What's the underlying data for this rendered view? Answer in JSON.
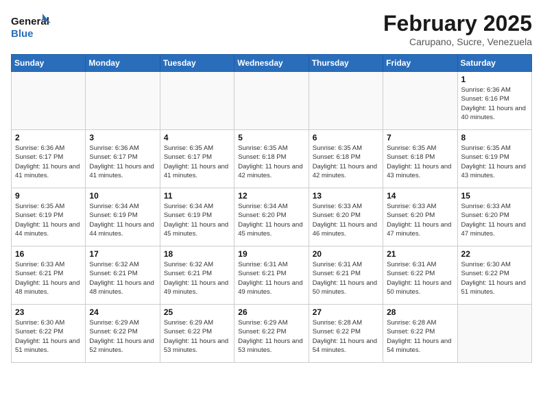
{
  "header": {
    "logo_line1": "General",
    "logo_line2": "Blue",
    "month": "February 2025",
    "location": "Carupano, Sucre, Venezuela"
  },
  "weekdays": [
    "Sunday",
    "Monday",
    "Tuesday",
    "Wednesday",
    "Thursday",
    "Friday",
    "Saturday"
  ],
  "weeks": [
    [
      {
        "day": "",
        "sunrise": "",
        "sunset": "",
        "daylight": ""
      },
      {
        "day": "",
        "sunrise": "",
        "sunset": "",
        "daylight": ""
      },
      {
        "day": "",
        "sunrise": "",
        "sunset": "",
        "daylight": ""
      },
      {
        "day": "",
        "sunrise": "",
        "sunset": "",
        "daylight": ""
      },
      {
        "day": "",
        "sunrise": "",
        "sunset": "",
        "daylight": ""
      },
      {
        "day": "",
        "sunrise": "",
        "sunset": "",
        "daylight": ""
      },
      {
        "day": "1",
        "sunrise": "Sunrise: 6:36 AM",
        "sunset": "Sunset: 6:16 PM",
        "daylight": "Daylight: 11 hours and 40 minutes."
      }
    ],
    [
      {
        "day": "2",
        "sunrise": "Sunrise: 6:36 AM",
        "sunset": "Sunset: 6:17 PM",
        "daylight": "Daylight: 11 hours and 41 minutes."
      },
      {
        "day": "3",
        "sunrise": "Sunrise: 6:36 AM",
        "sunset": "Sunset: 6:17 PM",
        "daylight": "Daylight: 11 hours and 41 minutes."
      },
      {
        "day": "4",
        "sunrise": "Sunrise: 6:35 AM",
        "sunset": "Sunset: 6:17 PM",
        "daylight": "Daylight: 11 hours and 41 minutes."
      },
      {
        "day": "5",
        "sunrise": "Sunrise: 6:35 AM",
        "sunset": "Sunset: 6:18 PM",
        "daylight": "Daylight: 11 hours and 42 minutes."
      },
      {
        "day": "6",
        "sunrise": "Sunrise: 6:35 AM",
        "sunset": "Sunset: 6:18 PM",
        "daylight": "Daylight: 11 hours and 42 minutes."
      },
      {
        "day": "7",
        "sunrise": "Sunrise: 6:35 AM",
        "sunset": "Sunset: 6:18 PM",
        "daylight": "Daylight: 11 hours and 43 minutes."
      },
      {
        "day": "8",
        "sunrise": "Sunrise: 6:35 AM",
        "sunset": "Sunset: 6:19 PM",
        "daylight": "Daylight: 11 hours and 43 minutes."
      }
    ],
    [
      {
        "day": "9",
        "sunrise": "Sunrise: 6:35 AM",
        "sunset": "Sunset: 6:19 PM",
        "daylight": "Daylight: 11 hours and 44 minutes."
      },
      {
        "day": "10",
        "sunrise": "Sunrise: 6:34 AM",
        "sunset": "Sunset: 6:19 PM",
        "daylight": "Daylight: 11 hours and 44 minutes."
      },
      {
        "day": "11",
        "sunrise": "Sunrise: 6:34 AM",
        "sunset": "Sunset: 6:19 PM",
        "daylight": "Daylight: 11 hours and 45 minutes."
      },
      {
        "day": "12",
        "sunrise": "Sunrise: 6:34 AM",
        "sunset": "Sunset: 6:20 PM",
        "daylight": "Daylight: 11 hours and 45 minutes."
      },
      {
        "day": "13",
        "sunrise": "Sunrise: 6:33 AM",
        "sunset": "Sunset: 6:20 PM",
        "daylight": "Daylight: 11 hours and 46 minutes."
      },
      {
        "day": "14",
        "sunrise": "Sunrise: 6:33 AM",
        "sunset": "Sunset: 6:20 PM",
        "daylight": "Daylight: 11 hours and 47 minutes."
      },
      {
        "day": "15",
        "sunrise": "Sunrise: 6:33 AM",
        "sunset": "Sunset: 6:20 PM",
        "daylight": "Daylight: 11 hours and 47 minutes."
      }
    ],
    [
      {
        "day": "16",
        "sunrise": "Sunrise: 6:33 AM",
        "sunset": "Sunset: 6:21 PM",
        "daylight": "Daylight: 11 hours and 48 minutes."
      },
      {
        "day": "17",
        "sunrise": "Sunrise: 6:32 AM",
        "sunset": "Sunset: 6:21 PM",
        "daylight": "Daylight: 11 hours and 48 minutes."
      },
      {
        "day": "18",
        "sunrise": "Sunrise: 6:32 AM",
        "sunset": "Sunset: 6:21 PM",
        "daylight": "Daylight: 11 hours and 49 minutes."
      },
      {
        "day": "19",
        "sunrise": "Sunrise: 6:31 AM",
        "sunset": "Sunset: 6:21 PM",
        "daylight": "Daylight: 11 hours and 49 minutes."
      },
      {
        "day": "20",
        "sunrise": "Sunrise: 6:31 AM",
        "sunset": "Sunset: 6:21 PM",
        "daylight": "Daylight: 11 hours and 50 minutes."
      },
      {
        "day": "21",
        "sunrise": "Sunrise: 6:31 AM",
        "sunset": "Sunset: 6:22 PM",
        "daylight": "Daylight: 11 hours and 50 minutes."
      },
      {
        "day": "22",
        "sunrise": "Sunrise: 6:30 AM",
        "sunset": "Sunset: 6:22 PM",
        "daylight": "Daylight: 11 hours and 51 minutes."
      }
    ],
    [
      {
        "day": "23",
        "sunrise": "Sunrise: 6:30 AM",
        "sunset": "Sunset: 6:22 PM",
        "daylight": "Daylight: 11 hours and 51 minutes."
      },
      {
        "day": "24",
        "sunrise": "Sunrise: 6:29 AM",
        "sunset": "Sunset: 6:22 PM",
        "daylight": "Daylight: 11 hours and 52 minutes."
      },
      {
        "day": "25",
        "sunrise": "Sunrise: 6:29 AM",
        "sunset": "Sunset: 6:22 PM",
        "daylight": "Daylight: 11 hours and 53 minutes."
      },
      {
        "day": "26",
        "sunrise": "Sunrise: 6:29 AM",
        "sunset": "Sunset: 6:22 PM",
        "daylight": "Daylight: 11 hours and 53 minutes."
      },
      {
        "day": "27",
        "sunrise": "Sunrise: 6:28 AM",
        "sunset": "Sunset: 6:22 PM",
        "daylight": "Daylight: 11 hours and 54 minutes."
      },
      {
        "day": "28",
        "sunrise": "Sunrise: 6:28 AM",
        "sunset": "Sunset: 6:22 PM",
        "daylight": "Daylight: 11 hours and 54 minutes."
      },
      {
        "day": "",
        "sunrise": "",
        "sunset": "",
        "daylight": ""
      }
    ]
  ]
}
